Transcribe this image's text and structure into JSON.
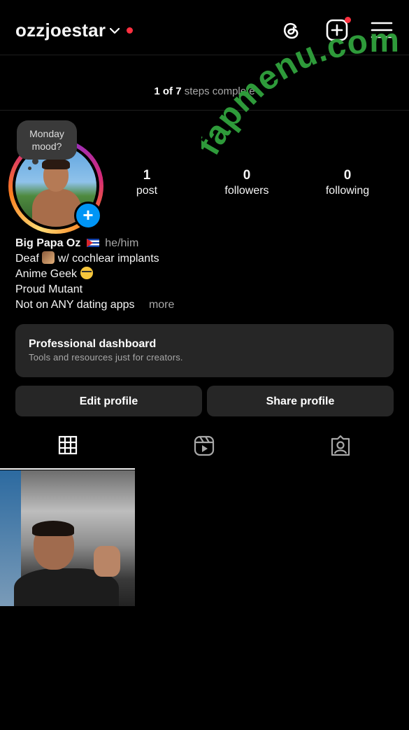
{
  "header": {
    "username": "ozzjoestar",
    "threads_icon": "threads-icon",
    "create_icon": "create-plus-icon",
    "menu_icon": "hamburger-menu-icon"
  },
  "steps": {
    "done": "1 of 7",
    "label": "steps complete"
  },
  "note": {
    "text": "Monday mood?"
  },
  "stats": [
    {
      "value": "1",
      "label": "post"
    },
    {
      "value": "0",
      "label": "followers"
    },
    {
      "value": "0",
      "label": "following"
    }
  ],
  "bio": {
    "name": "Big Papa Oz",
    "pronouns": "he/him",
    "line1_prefix": "Deaf",
    "line1_suffix": "w/ cochlear implants",
    "line2": "Anime Geek",
    "line3": "Proud Mutant",
    "line4": "Not on ANY dating apps",
    "more": "more"
  },
  "dashboard": {
    "title": "Professional dashboard",
    "subtitle": "Tools and resources just for creators."
  },
  "buttons": {
    "edit": "Edit profile",
    "share": "Share profile"
  },
  "tabs": [
    "grid-icon",
    "reels-icon",
    "tagged-icon"
  ],
  "watermark": "fapmenu.com",
  "colors": {
    "accent": "#0095f6",
    "notification": "#ff3040",
    "watermark": "#2e9a3a",
    "surface": "#262626"
  }
}
